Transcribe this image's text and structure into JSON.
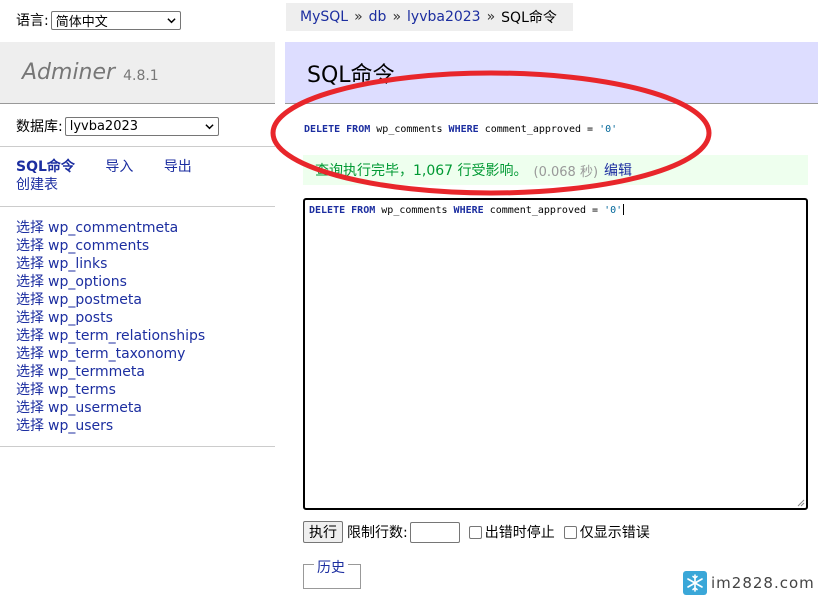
{
  "language": {
    "label": "语言:",
    "selected": "简体中文"
  },
  "brand": {
    "name": "Adminer",
    "version": "4.8.1"
  },
  "database": {
    "label": "数据库:",
    "selected": "lyvba2023"
  },
  "menu": {
    "sql": "SQL命令",
    "import": "导入",
    "export": "导出",
    "create_table": "创建表"
  },
  "tables": {
    "select_label": "选择",
    "items": [
      "wp_commentmeta",
      "wp_comments",
      "wp_links",
      "wp_options",
      "wp_postmeta",
      "wp_posts",
      "wp_term_relationships",
      "wp_term_taxonomy",
      "wp_termmeta",
      "wp_terms",
      "wp_usermeta",
      "wp_users"
    ]
  },
  "breadcrumb": {
    "mysql": "MySQL",
    "sep": "»",
    "db": "db",
    "database": "lyvba2023",
    "current": "SQL命令"
  },
  "page_title": "SQL命令",
  "executed_query": {
    "kw1": "DELETE",
    "kw2": "FROM",
    "table": "wp_comments",
    "kw3": "WHERE",
    "condition": "comment_approved =",
    "value": "'0'"
  },
  "result": {
    "message": "查询执行完毕，1,067 行受影响。",
    "time": "(0.068 秒)",
    "edit": "编辑"
  },
  "editor": {
    "kw1": "DELETE",
    "kw2": "FROM",
    "table": "wp_comments",
    "kw3": "WHERE",
    "condition": "comment_approved =",
    "value": "'0'"
  },
  "controls": {
    "execute": "执行",
    "limit_label": "限制行数:",
    "limit_value": "",
    "stop_on_error": "出错时停止",
    "show_only_errors": "仅显示错误"
  },
  "history": {
    "legend": "历史"
  },
  "watermark": {
    "text": "im2828.com"
  },
  "colors": {
    "link": "#1c2ea0",
    "header_bg": "#ddf",
    "success_bg": "#efe",
    "annotation": "#e8262b"
  }
}
